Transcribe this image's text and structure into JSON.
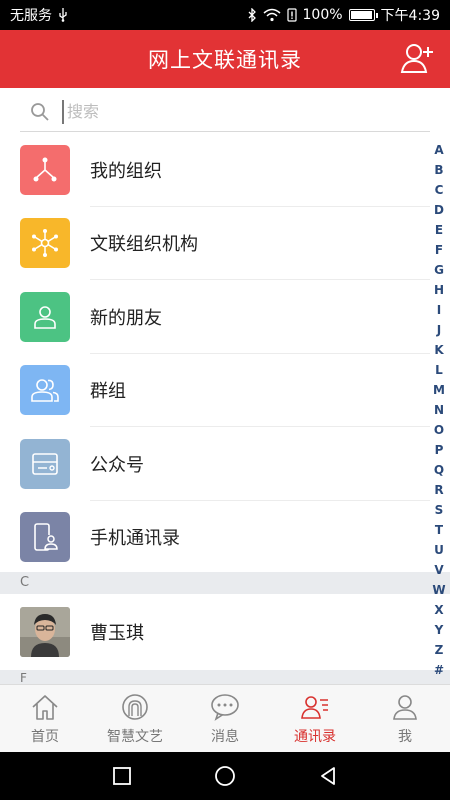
{
  "status_bar": {
    "carrier": "无服务",
    "battery": "100%",
    "battery_level": 1.0,
    "time": "下午4:39"
  },
  "header": {
    "title": "网上文联通讯录",
    "add_contact_icon": "person-plus-icon"
  },
  "search": {
    "placeholder": "搜索"
  },
  "menu": [
    {
      "label": "我的组织",
      "icon": "org-tree-icon",
      "color": "#f46d6d"
    },
    {
      "label": "文联组织机构",
      "icon": "network-hub-icon",
      "color": "#f8b72a"
    },
    {
      "label": "新的朋友",
      "icon": "person-icon",
      "color": "#4cc383"
    },
    {
      "label": "群组",
      "icon": "group-icon",
      "color": "#7eb6f3"
    },
    {
      "label": "公众号",
      "icon": "official-account-icon",
      "color": "#93b4d3"
    },
    {
      "label": "手机通讯录",
      "icon": "phone-contact-icon",
      "color": "#7b84a6"
    }
  ],
  "sections": [
    {
      "letter": "C",
      "contacts": [
        {
          "name": "曹玉琪"
        }
      ]
    },
    {
      "letter": "F"
    }
  ],
  "alphabet": [
    "A",
    "B",
    "C",
    "D",
    "E",
    "F",
    "G",
    "H",
    "I",
    "J",
    "K",
    "L",
    "M",
    "N",
    "O",
    "P",
    "Q",
    "R",
    "S",
    "T",
    "U",
    "V",
    "W",
    "X",
    "Y",
    "Z",
    "#"
  ],
  "tabs": [
    {
      "label": "首页",
      "icon": "home-icon",
      "active": false
    },
    {
      "label": "智慧文艺",
      "icon": "arch-icon",
      "active": false
    },
    {
      "label": "消息",
      "icon": "chat-bubbles-icon",
      "active": false
    },
    {
      "label": "通讯录",
      "icon": "contacts-icon",
      "active": true
    },
    {
      "label": "我",
      "icon": "user-icon",
      "active": false
    }
  ],
  "colors": {
    "brand_red": "#e23335",
    "active_tab": "#d8322f",
    "alphabet": "#2b4a7a"
  }
}
